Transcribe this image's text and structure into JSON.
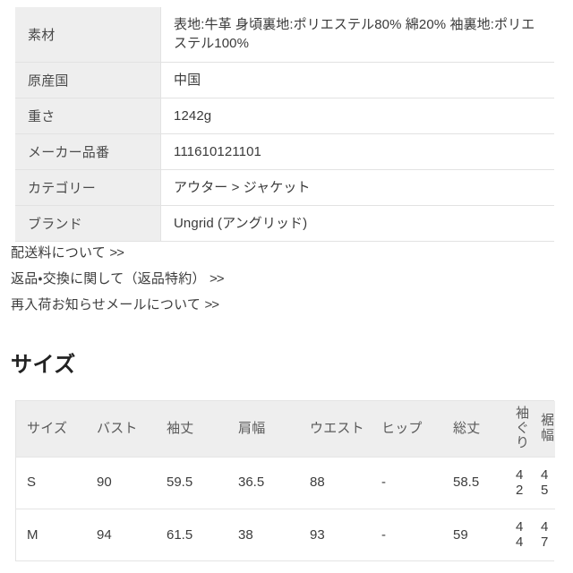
{
  "spec_table": {
    "rows": [
      {
        "label": "素材",
        "value": "表地:牛革 身頃裏地:ポリエステル80% 綿20% 袖裏地:ポリエステル100%",
        "tall": true
      },
      {
        "label": "原産国",
        "value": "中国",
        "tall": false
      },
      {
        "label": "重さ",
        "value": "1242g",
        "tall": false
      },
      {
        "label": "メーカー品番",
        "value": "111610121101",
        "tall": false
      },
      {
        "label": "カテゴリー",
        "value": "アウター > ジャケット",
        "tall": false
      },
      {
        "label": "ブランド",
        "value": "Ungrid (アングリッド)",
        "tall": false
      }
    ]
  },
  "links": [
    {
      "text": "配送料について",
      "chevron": ">>"
    },
    {
      "text": "返品・交換に関して（返品特約）",
      "chevron": ">>"
    },
    {
      "text": "再入荷お知らせメールについて",
      "chevron": ">>"
    }
  ],
  "size_section": {
    "heading": "サイズ",
    "columns": [
      "サイズ",
      "バスト",
      "袖丈",
      "肩幅",
      "ウエスト",
      "ヒップ",
      "総丈",
      "袖ぐり",
      "裾幅"
    ],
    "rows": [
      {
        "size": "S",
        "bust": "90",
        "sleeve": "59.5",
        "shoulder": "36.5",
        "waist": "88",
        "hip": "-",
        "length": "58.5",
        "armhole": "42",
        "hem": "45"
      },
      {
        "size": "M",
        "bust": "94",
        "sleeve": "61.5",
        "shoulder": "38",
        "waist": "93",
        "hip": "-",
        "length": "59",
        "armhole": "44",
        "hem": "47"
      }
    ]
  },
  "colors": {
    "page_background": "#ffffff",
    "label_cell_background": "#eeeeee",
    "header_row_background": "#eeeeee",
    "border": "#e2e2e2",
    "body_text": "#3c3c3c",
    "label_text": "#4a4a4a",
    "heading_text": "#222222"
  }
}
